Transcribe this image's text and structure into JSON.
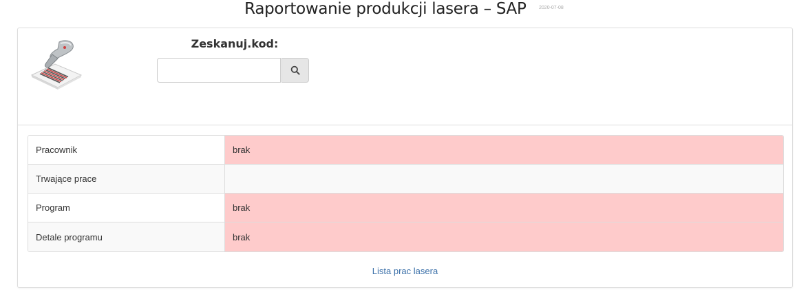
{
  "header": {
    "title": "Raportowanie produkcji lasera – SAP",
    "version": "2020-07-08"
  },
  "scan": {
    "label": "Zeskanuj.kod:",
    "value": "",
    "placeholder": ""
  },
  "info_rows": [
    {
      "label": "Pracownik",
      "value": "brak"
    },
    {
      "label": "Trwające prace",
      "value": ""
    },
    {
      "label": "Program",
      "value": "brak"
    },
    {
      "label": "Detale programu",
      "value": "brak"
    }
  ],
  "footer": {
    "link_label": "Lista prac lasera"
  },
  "colors": {
    "danger_bg": "#fecbcb",
    "link": "#3a6fa8"
  }
}
